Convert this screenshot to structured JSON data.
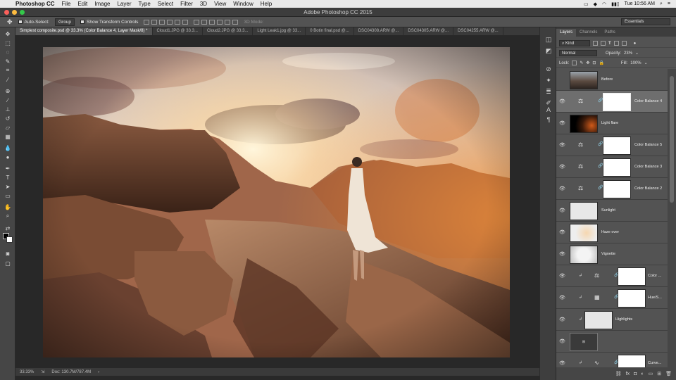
{
  "menubar": {
    "app": "Photoshop CC",
    "items": [
      "File",
      "Edit",
      "Image",
      "Layer",
      "Type",
      "Select",
      "Filter",
      "3D",
      "View",
      "Window",
      "Help"
    ],
    "clock": "Tue 10:56 AM"
  },
  "window": {
    "title": "Adobe Photoshop CC 2015"
  },
  "options": {
    "auto_select_label": "Auto-Select:",
    "auto_select_value": "Group",
    "show_transform_label": "Show Transform Controls",
    "mode_3d": "3D Mode:",
    "workspace": "Essentials"
  },
  "tabs": [
    "Simplest composite.psd @ 33.3% (Color Balance 4, Layer Mask/8) *",
    "Cloud1.JPG @ 33.3...",
    "Cloud2.JPG @ 33.3...",
    "Light Leak1.jpg @ 33...",
    "0 Botin final.psd @...",
    "DSC04308.ARW @...",
    "DSC04305.ARW @...",
    "DSC04255.ARW @..."
  ],
  "status": {
    "zoom": "33.33%",
    "doc": "Doc: 130.7M/787.4M"
  },
  "layers_panel": {
    "tabs": [
      "Layers",
      "Channels",
      "Paths"
    ],
    "kind": "Kind",
    "blend_mode": "Normal",
    "opacity_label": "Opacity:",
    "opacity_value": "23%",
    "lock_label": "Lock:",
    "fill_label": "Fill:",
    "fill_value": "100%",
    "layers": [
      {
        "name": "Before"
      },
      {
        "name": "Color Balance 4"
      },
      {
        "name": "Light flare"
      },
      {
        "name": "Color Balance 5"
      },
      {
        "name": "Color Balance 3"
      },
      {
        "name": "Color Balance 2"
      },
      {
        "name": "Sunlight"
      },
      {
        "name": "Haze over"
      },
      {
        "name": "Vignette"
      },
      {
        "name": "Color ..."
      },
      {
        "name": "Hue/S..."
      },
      {
        "name": "Highlights"
      },
      {
        "name": "Curve..."
      }
    ],
    "footer_icons": [
      "fx",
      "link-icon",
      "mask-icon",
      "adjustment-icon",
      "folder-icon",
      "new-layer-icon",
      "trash-icon"
    ]
  }
}
